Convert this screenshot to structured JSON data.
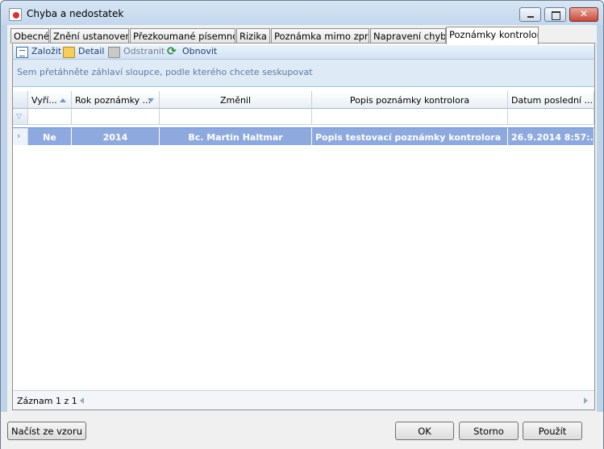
{
  "window": {
    "title": "Chyba a nedostatek"
  },
  "tabs": [
    {
      "label": "Obecné"
    },
    {
      "label": "Znění ustanovení"
    },
    {
      "label": "Přezkoumané písemnosti"
    },
    {
      "label": "Rizika"
    },
    {
      "label": "Poznámka mimo zprávu"
    },
    {
      "label": "Napravení chyby"
    },
    {
      "label": "Poznámky kontrolora",
      "active": true
    }
  ],
  "toolbar": {
    "create_label": "Založit",
    "detail_label": "Detail",
    "delete_label": "Odstranit",
    "refresh_label": "Obnovit"
  },
  "group_hint": "Sem přetáhněte záhlaví sloupce, podle kterého chcete seskupovat",
  "grid": {
    "columns": [
      {
        "label": "Vyří...",
        "sort": "asc"
      },
      {
        "label": "Rok poznámky ...",
        "sort": "desc"
      },
      {
        "label": "Změnil"
      },
      {
        "label": "Popis poznámky kontrolora"
      },
      {
        "label": "Datum poslední ..."
      }
    ],
    "rows": [
      {
        "resolved": "Ne",
        "year": "2014",
        "changed_by": "Bc. Martin Haltmar",
        "description": "Popis testovací poznámky kontrolora",
        "last_date": "26.9.2014 8:57:..."
      }
    ]
  },
  "status": {
    "record_text": "Záznam 1 z 1"
  },
  "footer": {
    "load_template_label": "Načíst ze vzoru",
    "ok_label": "OK",
    "cancel_label": "Storno",
    "apply_label": "Použít"
  },
  "icons": {
    "create": "new-document-icon",
    "detail": "folder-icon",
    "delete": "trash-icon",
    "refresh": "refresh-icon",
    "filter": "filter-icon"
  }
}
